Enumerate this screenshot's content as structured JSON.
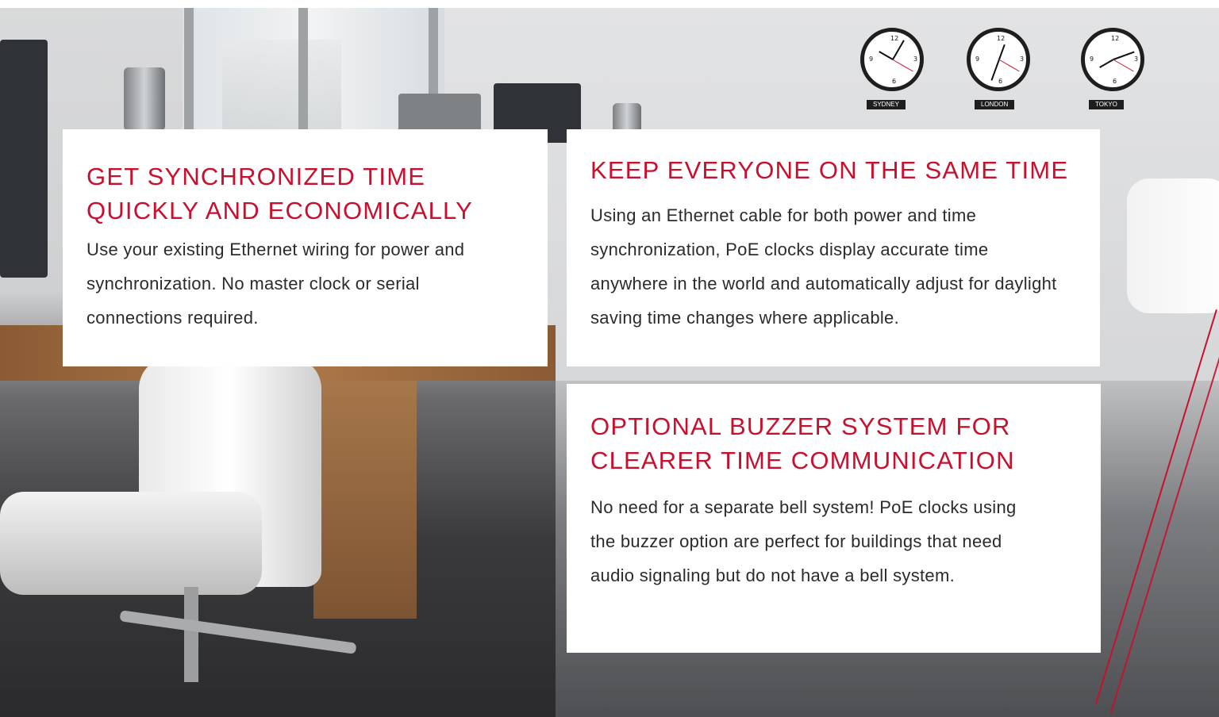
{
  "cards": [
    {
      "title": "GET SYNCHRONIZED TIME QUICKLY AND ECONOMICALLY",
      "body": "Use your existing Ethernet wiring for power and synchronization. No master clock or serial connections required."
    },
    {
      "title": "KEEP EVERYONE ON THE SAME TIME",
      "body": "Using an Ethernet cable for both power and time synchronization, PoE clocks display accurate time anywhere in the world and automatically adjust for daylight saving time changes where applicable."
    },
    {
      "title": "OPTIONAL BUZZER SYSTEM FOR CLEARER TIME COMMUNICATION",
      "body": "No need for a separate bell system! PoE clocks using the buzzer option are perfect for buildings that need audio signaling but do not have a bell system."
    }
  ],
  "clocks": {
    "labels": [
      "SYDNEY",
      "LONDON",
      "TOKYO"
    ]
  },
  "colors": {
    "accent": "#c8102e",
    "text": "#2b2b2b",
    "card_bg": "#ffffff"
  }
}
